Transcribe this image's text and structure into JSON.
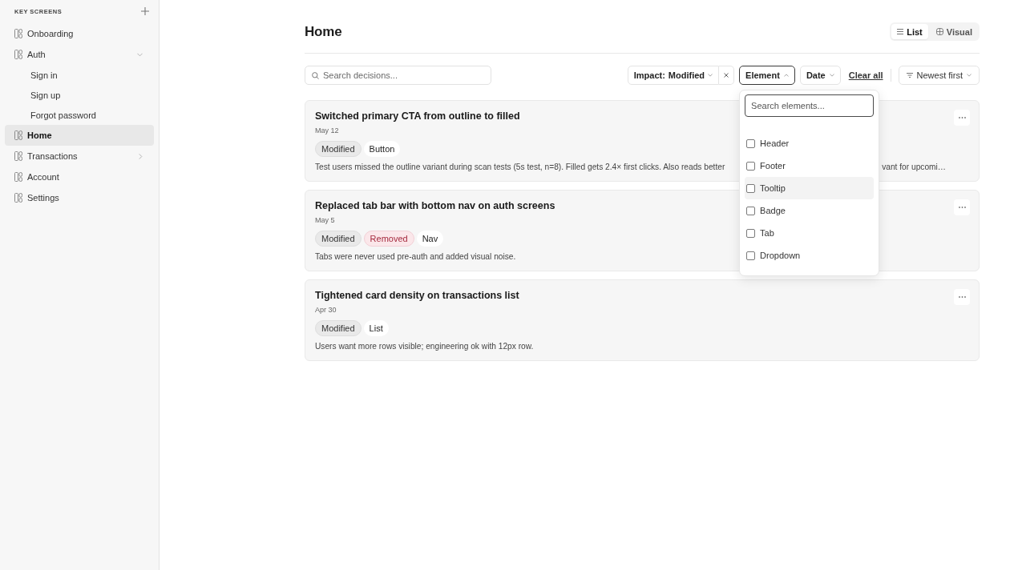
{
  "sidebar": {
    "heading": "KEY SCREENS",
    "items": [
      {
        "label": "Onboarding",
        "selected": false
      },
      {
        "label": "Auth",
        "selected": false,
        "expanded": true,
        "children": [
          {
            "label": "Sign in",
            "selected": false
          },
          {
            "label": "Sign up",
            "selected": false
          },
          {
            "label": "Forgot password",
            "selected": false
          }
        ]
      },
      {
        "label": "Home",
        "selected": true
      },
      {
        "label": "Transactions",
        "selected": false,
        "expanded": false
      },
      {
        "label": "Account",
        "selected": false
      },
      {
        "label": "Settings",
        "selected": false
      }
    ]
  },
  "header": {
    "title": "Home",
    "view_tabs": [
      {
        "label": "List",
        "selected": true
      },
      {
        "label": "Visual",
        "selected": false
      }
    ]
  },
  "toolbar": {
    "search": {
      "placeholder": "Search decisions..."
    },
    "filters": [
      {
        "kind": "value",
        "label": "Impact:",
        "value": "Modified",
        "open": false
      },
      {
        "kind": "plain",
        "label": "Element",
        "open": true,
        "menu": {
          "search": {
            "placeholder": "Search elements..."
          },
          "options": [
            {
              "label": "Header",
              "checked": false,
              "highlighted": false
            },
            {
              "label": "Footer",
              "checked": false,
              "highlighted": false
            },
            {
              "label": "Tooltip",
              "checked": false,
              "highlighted": true
            },
            {
              "label": "Badge",
              "checked": false,
              "highlighted": false
            },
            {
              "label": "Tab",
              "checked": false,
              "highlighted": false
            },
            {
              "label": "Dropdown",
              "checked": false,
              "highlighted": false
            }
          ]
        }
      },
      {
        "kind": "plain",
        "label": "Date",
        "open": false
      }
    ],
    "clear_all": "Clear all",
    "sort": "Newest first"
  },
  "decisions": [
    {
      "title": "Switched primary CTA from outline to filled",
      "date": "May 12",
      "tags": [
        {
          "label": "Modified",
          "kind": "modified"
        },
        {
          "label": "Button",
          "kind": "element"
        }
      ],
      "description": "Test users missed the outline variant during scan tests (5s test, n=8). Filled gets 2.4× first clicks. Also reads better",
      "description_end": "vant for upcomi…"
    },
    {
      "title": "Replaced tab bar with bottom nav on auth screens",
      "date": "May 5",
      "tags": [
        {
          "label": "Modified",
          "kind": "modified"
        },
        {
          "label": "Removed",
          "kind": "removed"
        },
        {
          "label": "Nav",
          "kind": "element"
        }
      ],
      "description": "Tabs were never used pre-auth and added visual noise."
    },
    {
      "title": "Tightened card density on transactions list",
      "date": "Apr 30",
      "tags": [
        {
          "label": "Modified",
          "kind": "modified"
        },
        {
          "label": "List",
          "kind": "element"
        }
      ],
      "description": "Users want more rows visible; engineering ok with 12px row."
    }
  ]
}
